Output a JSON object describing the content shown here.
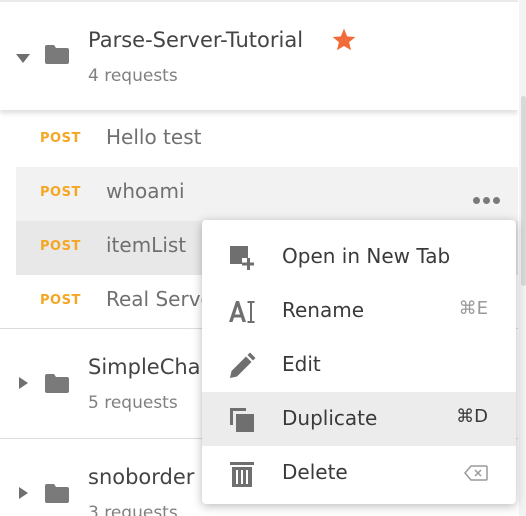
{
  "collections": [
    {
      "name": "Parse-Server-Tutorial",
      "count": "4 requests",
      "expanded": true,
      "favorite": true
    },
    {
      "name": "SimpleCha",
      "count": "5 requests",
      "expanded": false
    },
    {
      "name": "snoborder",
      "count": "3 requests",
      "expanded": false
    }
  ],
  "requests": [
    {
      "method": "POST",
      "name": "Hello test"
    },
    {
      "method": "POST",
      "name": "whoami"
    },
    {
      "method": "POST",
      "name": "itemList"
    },
    {
      "method": "POST",
      "name": "Real Serve"
    }
  ],
  "context_menu": {
    "items": [
      {
        "label": "Open in New Tab",
        "shortcut": "",
        "icon": "open-new-tab-icon"
      },
      {
        "label": "Rename",
        "shortcut": "⌘E",
        "icon": "rename-icon"
      },
      {
        "label": "Edit",
        "shortcut": "",
        "icon": "pencil-icon"
      },
      {
        "label": "Duplicate",
        "shortcut": "⌘D",
        "icon": "duplicate-icon"
      },
      {
        "label": "Delete",
        "shortcut": "",
        "icon": "trash-icon"
      }
    ]
  },
  "colors": {
    "method_post": "#f5a623",
    "star": "#f26b3a",
    "highlight": "#ececec"
  }
}
